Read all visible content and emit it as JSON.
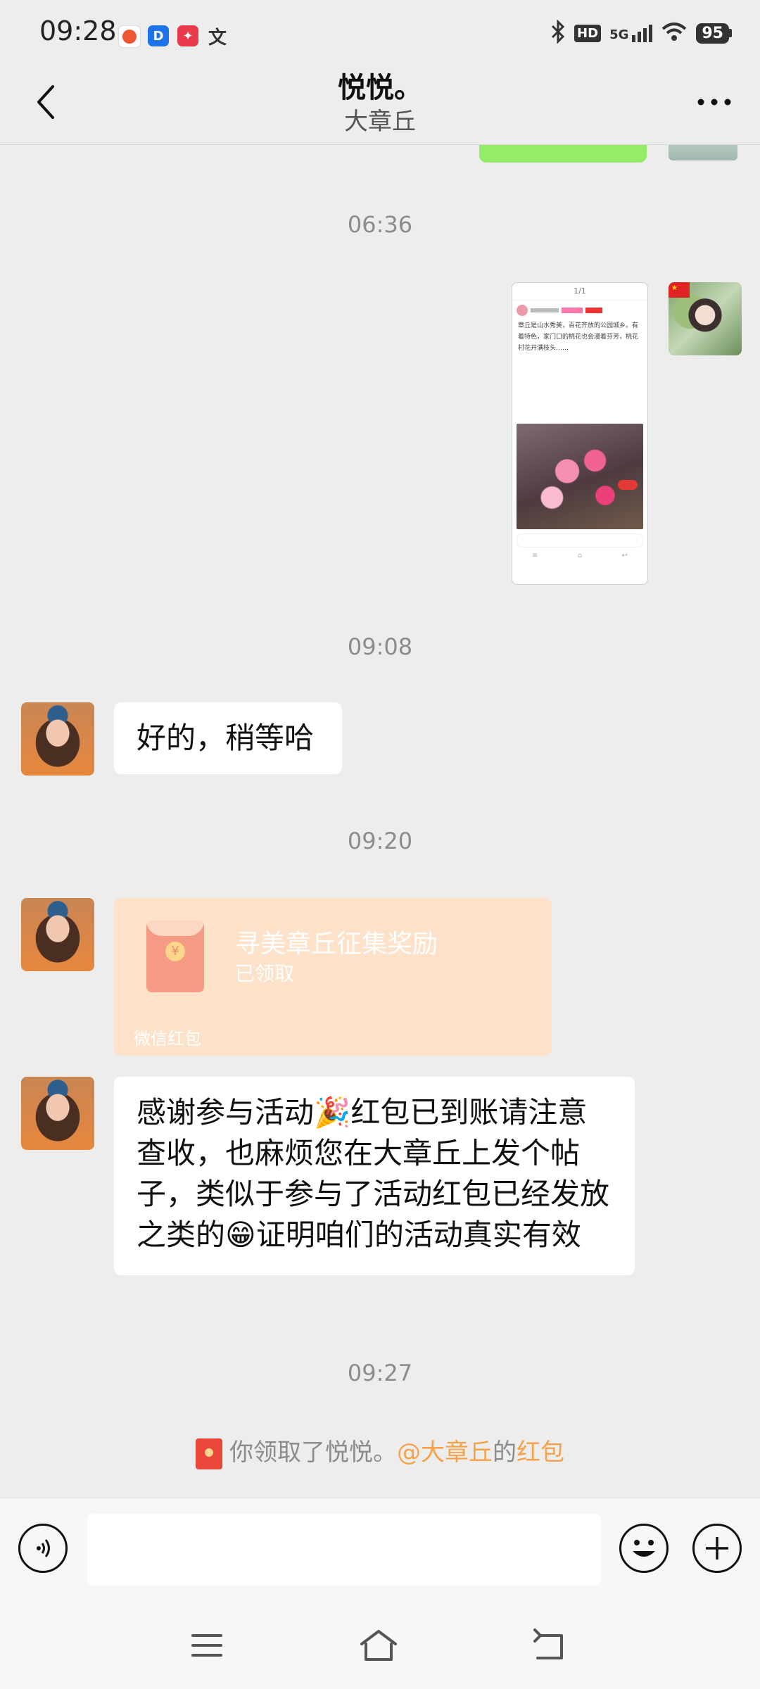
{
  "status_bar": {
    "time": "09:28",
    "signal_label": "5G",
    "hd_label": "HD",
    "battery": "95"
  },
  "header": {
    "title": "悦悦。",
    "subtitle": "大章丘"
  },
  "messages": {
    "ts1": "06:36",
    "ts2": "09:08",
    "reply1": "好的，稍等哈",
    "ts3": "09:20",
    "red_packet": {
      "title": "寻美章丘征集奖励",
      "status": "已领取",
      "footer": "微信红包"
    },
    "reply2_part1": "感谢参与活动",
    "reply2_part2": "红包已到账请注意查收，也麻烦您在大章丘上发个帖子，类似于参与了活动红包已经发放之类的",
    "reply2_part3": "证明咱们的活动真实有效",
    "ts4": "09:27",
    "notice": {
      "prefix": "你领取了悦悦。",
      "mention": "@大章丘",
      "middle": "的",
      "link": "红包"
    }
  },
  "screenshot_card": {
    "page_indicator": "1/1",
    "text": "章丘是山水秀美，百花齐放的公园城乡。有着特色，家门口的桃花也会漫着芬芳，桃花村花开满枝头……"
  },
  "colors": {
    "bg": "#ededed",
    "bubble_self": "#95ec69",
    "red_packet": "#fde2c9",
    "accent_orange": "#f5a24a"
  }
}
